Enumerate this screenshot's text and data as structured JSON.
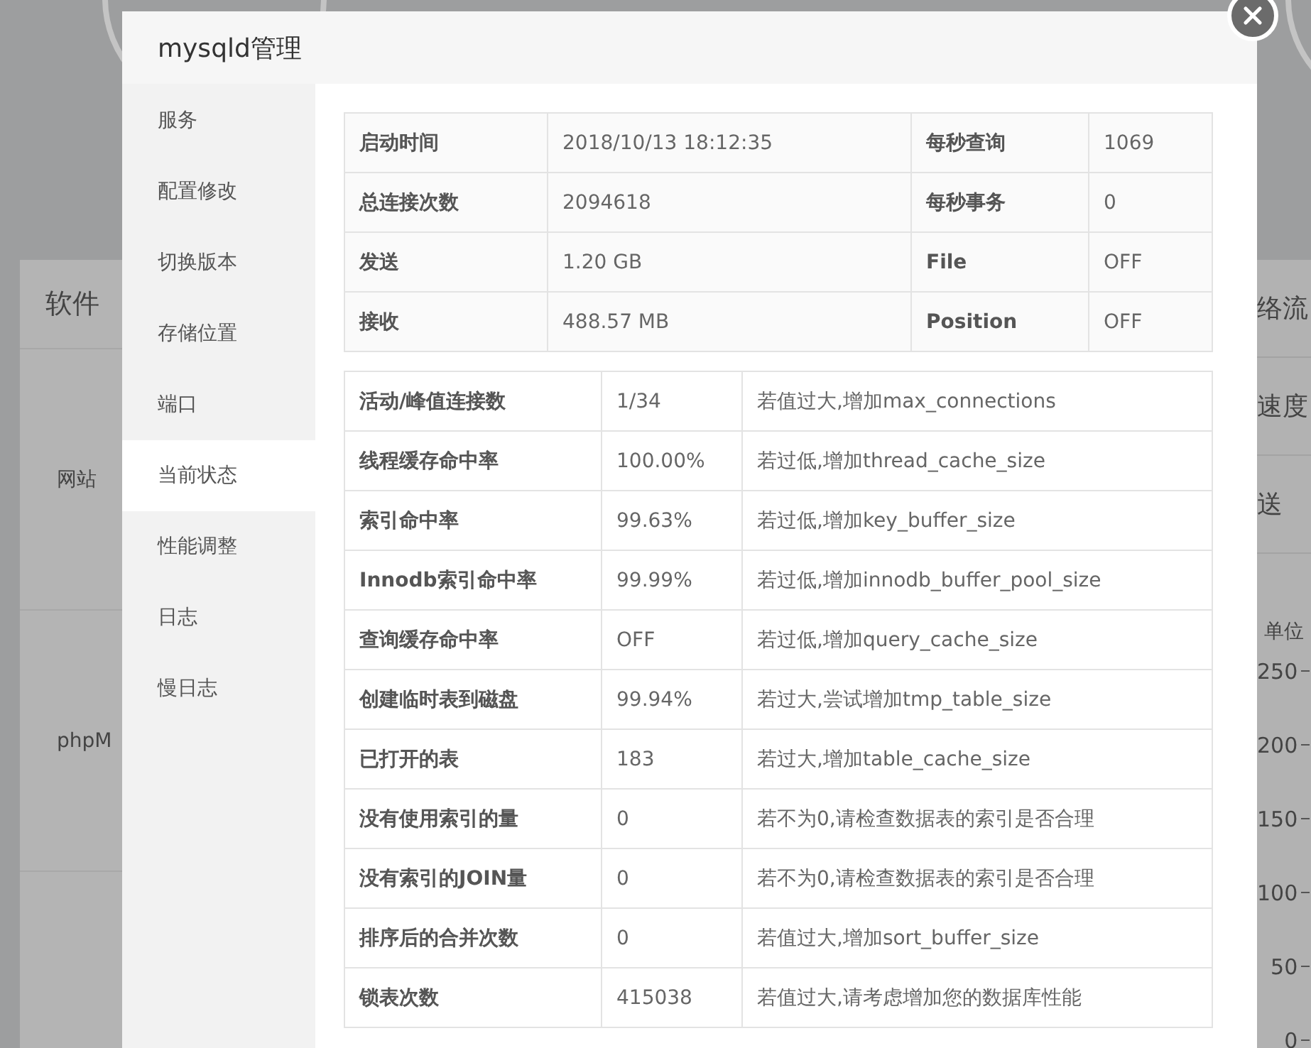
{
  "background": {
    "left": {
      "title": "软件",
      "items": [
        "网站",
        "phpM"
      ]
    },
    "right": {
      "items": [
        "络流",
        "速度",
        "送"
      ],
      "axis_label": "单位",
      "ticks": [
        "250",
        "200",
        "150",
        "100",
        "50",
        "0"
      ]
    }
  },
  "modal": {
    "title": "mysqld管理",
    "menu": [
      {
        "label": "服务",
        "selected": false
      },
      {
        "label": "配置修改",
        "selected": false
      },
      {
        "label": "切换版本",
        "selected": false
      },
      {
        "label": "存储位置",
        "selected": false
      },
      {
        "label": "端口",
        "selected": false
      },
      {
        "label": "当前状态",
        "selected": true
      },
      {
        "label": "性能调整",
        "selected": false
      },
      {
        "label": "日志",
        "selected": false
      },
      {
        "label": "慢日志",
        "selected": false
      }
    ],
    "status_table": [
      [
        "启动时间",
        "2018/10/13 18:12:35",
        "每秒查询",
        "1069"
      ],
      [
        "总连接次数",
        "2094618",
        "每秒事务",
        "0"
      ],
      [
        "发送",
        "1.20 GB",
        "File",
        "OFF"
      ],
      [
        "接收",
        "488.57 MB",
        "Position",
        "OFF"
      ]
    ],
    "perf_table": [
      {
        "name": "活动/峰值连接数",
        "value": "1/34",
        "hint": "若值过大,增加max_connections"
      },
      {
        "name": "线程缓存命中率",
        "value": "100.00%",
        "hint": "若过低,增加thread_cache_size"
      },
      {
        "name": "索引命中率",
        "value": "99.63%",
        "hint": "若过低,增加key_buffer_size"
      },
      {
        "name": "Innodb索引命中率",
        "value": "99.99%",
        "hint": "若过低,增加innodb_buffer_pool_size"
      },
      {
        "name": "查询缓存命中率",
        "value": "OFF",
        "hint": "若过低,增加query_cache_size"
      },
      {
        "name": "创建临时表到磁盘",
        "value": "99.94%",
        "hint": "若过大,尝试增加tmp_table_size"
      },
      {
        "name": "已打开的表",
        "value": "183",
        "hint": "若过大,增加table_cache_size"
      },
      {
        "name": "没有使用索引的量",
        "value": "0",
        "hint": "若不为0,请检查数据表的索引是否合理"
      },
      {
        "name": "没有索引的JOIN量",
        "value": "0",
        "hint": "若不为0,请检查数据表的索引是否合理"
      },
      {
        "name": "排序后的合并次数",
        "value": "0",
        "hint": "若值过大,增加sort_buffer_size"
      },
      {
        "name": "锁表次数",
        "value": "415038",
        "hint": "若值过大,请考虑增加您的数据库性能"
      }
    ]
  }
}
